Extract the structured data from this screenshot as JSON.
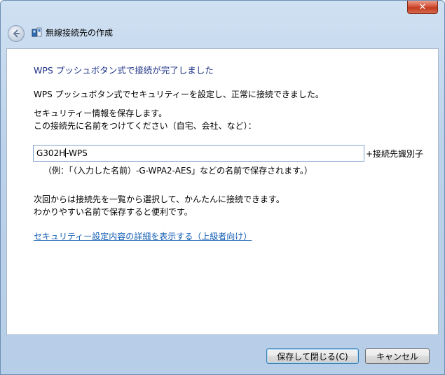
{
  "window": {
    "title": "無線接続先の作成",
    "close_glyph": "✕"
  },
  "content": {
    "heading": "WPS プッシュボタン式で接続が完了しました",
    "line1": "WPS プッシュボタン式でセキュリティーを設定し、正常に接続できました。",
    "line2": "セキュリティー情報を保存します。",
    "line3": "この接続先に名前をつけてください（自宅、会社、など）：",
    "name_input_before_caret": "G302H",
    "name_input_after_caret": "-WPS",
    "suffix_label": "+接続先識別子",
    "example": "（例：「（入力した名前）-G-WPA2-AES」などの名前で保存されます。）",
    "line4": "次回からは接続先を一覧から選択して、かんたんに接続できます。",
    "line5": "わかりやすい名前で保存すると便利です。",
    "details_link": "セキュリティー設定内容の詳細を表示する（上級者向け）"
  },
  "buttons": {
    "save_close_label": "保存して閉じる(C)",
    "cancel_label": "キャンセル"
  },
  "colors": {
    "heading": "#1e3287",
    "link": "#0f5bb0",
    "close_button": "#c23a1f"
  },
  "icons": [
    "back-arrow-icon",
    "wireless-network-icon",
    "close-icon"
  ]
}
